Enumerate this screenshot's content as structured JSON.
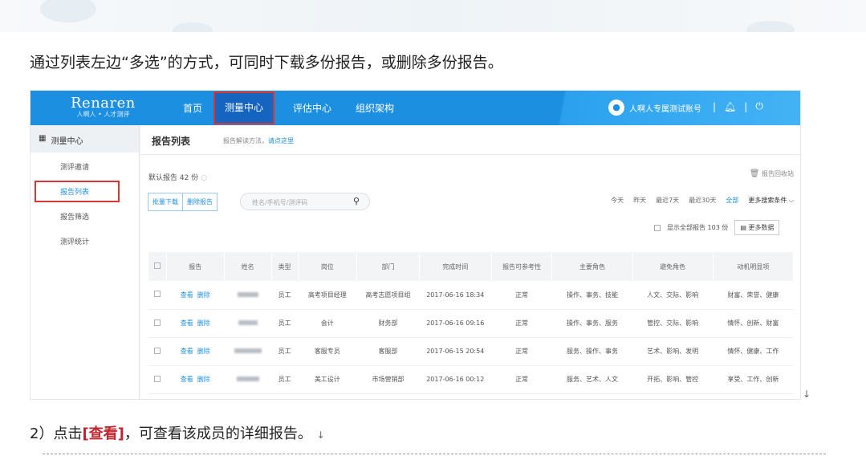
{
  "doc": {
    "paragraph1": "通过列表左边“多选”的方式，可同时下载多份报告，或删除多份报告。",
    "paragraph2_prefix": "2）点击",
    "paragraph2_em": "[查看]",
    "paragraph2_suffix": "，可查看该成员的详细报告。",
    "para_mark": "↓"
  },
  "nav": {
    "brand": "Renaren",
    "brand_sub": "人啊人 • 人才测评",
    "items": [
      "首页",
      "测量中心",
      "评估中心",
      "组织架构"
    ],
    "active_index": 1,
    "user_name": "人啊人专属测试账号",
    "separator": "|"
  },
  "sidebar": {
    "title": "测量中心",
    "items": [
      "测评邀请",
      "报告列表",
      "报告筛选",
      "测评统计"
    ],
    "active_index": 1
  },
  "main": {
    "title": "报告列表",
    "hint": "报告解读方法，",
    "hint_link": "请点这里",
    "count": "默认报告 42 份",
    "recycle": "报告回收站",
    "buttons": [
      "批量下载",
      "删除报告"
    ],
    "search_placeholder": "姓名/手机号/测评码",
    "filters": [
      "今天",
      "昨天",
      "最近7天",
      "最近30天",
      "全部"
    ],
    "filters_active": "全部",
    "more_filters": "更多搜索条件",
    "show_all": "显示全部报告 103 份",
    "more_data": "更多数据"
  },
  "table": {
    "headers": [
      "报告",
      "姓名",
      "类型",
      "岗位",
      "部门",
      "完成时间",
      "报告可参考性",
      "主要角色",
      "避免角色",
      "动机明显项"
    ],
    "action_view": "查看",
    "action_delete": "删除",
    "rows": [
      {
        "type": "员工",
        "position": "高考项目经理",
        "dept": "高考志愿项目组",
        "time": "2017-06-16 18:34",
        "ref": "正常",
        "main_role": "操作、事务、技能",
        "avoid_role": "人文、交际、影响",
        "motive": "财富、荣誉、健康"
      },
      {
        "type": "员工",
        "position": "会计",
        "dept": "财务部",
        "time": "2017-06-16 09:16",
        "ref": "正常",
        "main_role": "操作、事务、服务",
        "avoid_role": "管控、交际、影响",
        "motive": "情怀、创新、财富"
      },
      {
        "type": "员工",
        "position": "客服专员",
        "dept": "客服部",
        "time": "2017-06-15 20:54",
        "ref": "正常",
        "main_role": "服务、操作、事务",
        "avoid_role": "艺术、影响、发明",
        "motive": "情怀、健康、工作"
      },
      {
        "type": "员工",
        "position": "美工设计",
        "dept": "市场营销部",
        "time": "2017-06-16 00:12",
        "ref": "正常",
        "main_role": "服务、艺术、人文",
        "avoid_role": "开拓、影响、管控",
        "motive": "享受、工作、创新"
      }
    ]
  }
}
